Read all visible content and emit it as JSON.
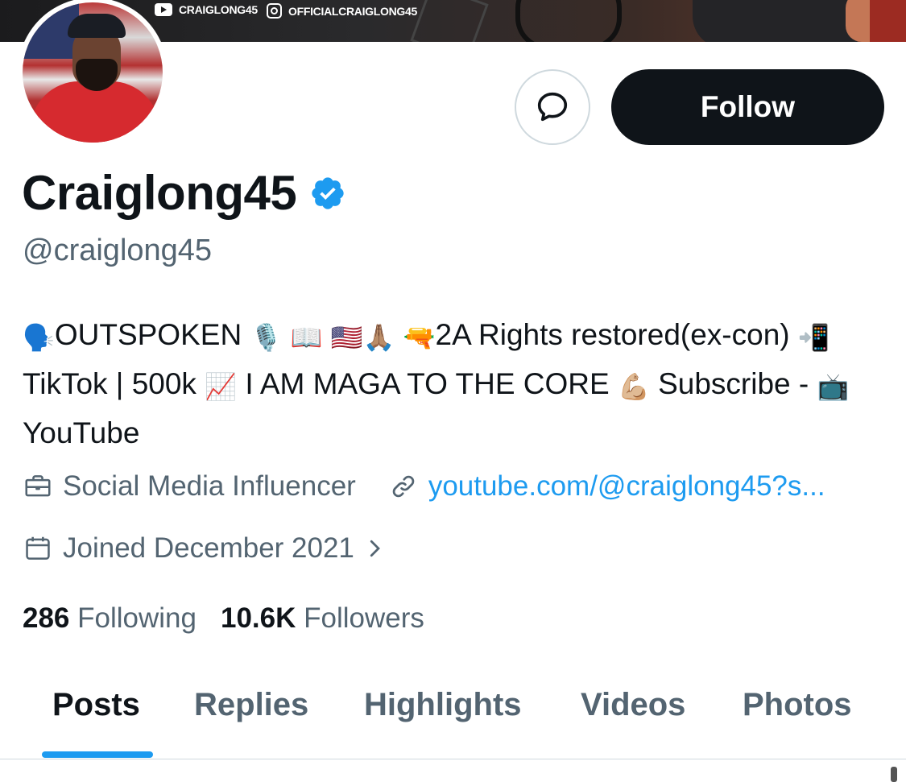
{
  "banner": {
    "youtube_handle": "CRAIGLONG45",
    "instagram_handle": "OFFICIALCRAIGLONG45"
  },
  "profile": {
    "display_name": "Craiglong45",
    "handle": "@craiglong45",
    "verified": true
  },
  "actions": {
    "follow_label": "Follow",
    "message_icon": "message-bubble-icon"
  },
  "bio": {
    "segments": [
      {
        "emoji": "🗣️"
      },
      {
        "text": "OUTSPOKEN "
      },
      {
        "emoji": "🎙️"
      },
      {
        "text": "  "
      },
      {
        "emoji": "📖"
      },
      {
        "text": " "
      },
      {
        "emoji": "🇺🇸"
      },
      {
        "emoji": "🙏🏽"
      },
      {
        "text": " "
      },
      {
        "emoji": "🔫"
      },
      {
        "text": "2A Rights restored(ex-con) "
      },
      {
        "emoji": "📲"
      },
      {
        "text": "TikTok | 500k "
      },
      {
        "emoji": "📈"
      },
      {
        "text": " I AM MAGA TO THE CORE "
      },
      {
        "emoji": "💪🏼"
      },
      {
        "text": " Subscribe - "
      },
      {
        "emoji": "📺"
      },
      {
        "text": " YouTube"
      }
    ]
  },
  "meta": {
    "category": "Social Media Influencer",
    "link": "youtube.com/@craiglong45?s...",
    "joined": "Joined December 2021"
  },
  "stats": {
    "following_count": "286",
    "following_label": "Following",
    "followers_count": "10.6K",
    "followers_label": "Followers"
  },
  "tabs": [
    {
      "label": "Posts",
      "active": true
    },
    {
      "label": "Replies",
      "active": false
    },
    {
      "label": "Highlights",
      "active": false
    },
    {
      "label": "Videos",
      "active": false
    },
    {
      "label": "Photos",
      "active": false
    }
  ],
  "colors": {
    "accent": "#1d9bf0",
    "text_primary": "#0f1419",
    "text_secondary": "#536471",
    "button_dark": "#0f1419"
  }
}
